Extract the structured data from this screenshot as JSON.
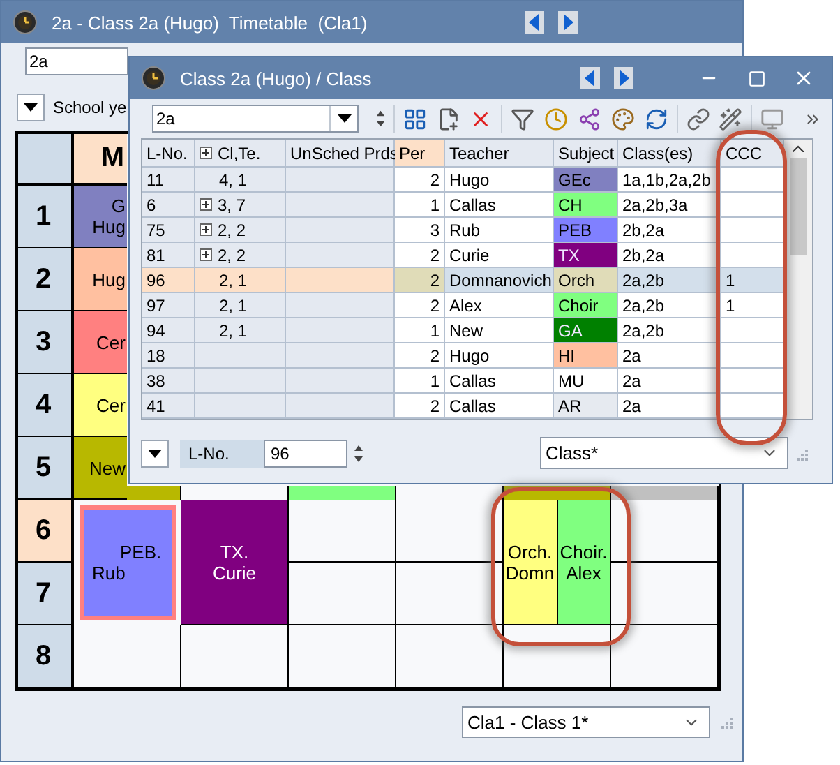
{
  "timetable_window": {
    "title": "2a - Class 2a (Hugo)  Timetable  (Cla1)",
    "class_field": {
      "value": "2a"
    },
    "view_label": "School ye",
    "day_headers": [
      {
        "label": "M",
        "highlighted": true
      }
    ],
    "periods": [
      {
        "label": "1",
        "highlighted": false,
        "cells": [
          {
            "kind": "lesson",
            "lines": [
              "G",
              "Hug"
            ],
            "color": "#8080c0"
          }
        ]
      },
      {
        "label": "2",
        "highlighted": false,
        "cells": [
          {
            "kind": "lesson",
            "lines": [
              "Hug"
            ],
            "color": "#ffc0a0"
          }
        ]
      },
      {
        "label": "3",
        "highlighted": false,
        "cells": [
          {
            "kind": "lesson",
            "lines": [
              "Cer"
            ],
            "color": "#ff8080"
          }
        ]
      },
      {
        "label": "4",
        "highlighted": false,
        "cells": [
          {
            "kind": "lesson",
            "lines": [
              "Cer"
            ],
            "color": "#ffff80"
          }
        ]
      },
      {
        "label": "5",
        "highlighted": false,
        "cells": [
          {
            "kind": "lesson",
            "lines": [
              "New"
            ],
            "color": "#b8b800"
          },
          {
            "kind": "empty"
          },
          {
            "kind": "block",
            "color": "#80ff80"
          },
          {
            "kind": "empty"
          },
          {
            "kind": "block",
            "color": "#b8b800"
          },
          {
            "kind": "block",
            "color": "#c0c0c0"
          }
        ]
      },
      {
        "label": "6",
        "highlighted": true,
        "cells": [
          {
            "kind": "lesson",
            "lines": [
              "PEB.",
              "Rub"
            ],
            "color": "#8080ff",
            "double": true,
            "marked": true
          },
          {
            "kind": "lesson",
            "lines": [
              "TX.",
              "Curie"
            ],
            "color": "#800080",
            "double": true,
            "marked": false
          },
          {
            "kind": "empty"
          },
          {
            "kind": "empty"
          },
          {
            "kind": "split",
            "double": true,
            "circled": true,
            "parts": [
              {
                "lines": [
                  "Orch.",
                  "Domn"
                ],
                "color": "#ffff80"
              },
              {
                "lines": [
                  "Choir.",
                  "Alex"
                ],
                "color": "#80ff80"
              }
            ]
          },
          {
            "kind": "empty"
          }
        ]
      },
      {
        "label": "7",
        "highlighted": false,
        "cells": [
          {
            "kind": "covered"
          },
          {
            "kind": "covered"
          },
          {
            "kind": "empty"
          },
          {
            "kind": "empty"
          },
          {
            "kind": "covered"
          },
          {
            "kind": "empty"
          }
        ]
      },
      {
        "label": "8",
        "highlighted": false,
        "cells": [
          {
            "kind": "empty"
          },
          {
            "kind": "empty"
          },
          {
            "kind": "empty"
          },
          {
            "kind": "empty"
          },
          {
            "kind": "empty"
          },
          {
            "kind": "empty"
          }
        ]
      }
    ],
    "format_select": {
      "value": "Cla1 - Class 1*"
    }
  },
  "class_window": {
    "title": "Class 2a (Hugo) / Class",
    "class_field": {
      "value": "2a"
    },
    "columns": [
      {
        "label": "L-No.",
        "expandable": false,
        "highlighted": false,
        "circled": false
      },
      {
        "label": "Cl,Te.",
        "expandable": true,
        "highlighted": false,
        "circled": false
      },
      {
        "label": "UnSched Prds",
        "expandable": false,
        "highlighted": false,
        "circled": false
      },
      {
        "label": "Per",
        "expandable": false,
        "highlighted": true,
        "circled": false
      },
      {
        "label": "Teacher",
        "expandable": false,
        "highlighted": false,
        "circled": false
      },
      {
        "label": "Subject",
        "expandable": false,
        "highlighted": false,
        "circled": false
      },
      {
        "label": "Class(es)",
        "expandable": false,
        "highlighted": false,
        "circled": false
      },
      {
        "label": "CCC",
        "expandable": false,
        "highlighted": false,
        "circled": true
      }
    ],
    "rows": [
      {
        "lno": "11",
        "cl_te": "4, 1",
        "expandable": false,
        "per": "2",
        "teacher": "Hugo",
        "subject": "GEc",
        "color": "#8080c0",
        "classes": "1a,1b,2a,2b",
        "selected": false
      },
      {
        "lno": "6",
        "cl_te": "3, 7",
        "expandable": true,
        "per": "1",
        "teacher": "Callas",
        "subject": "CH",
        "color": "#80ff80",
        "classes": "2a,2b,3a",
        "selected": false
      },
      {
        "lno": "75",
        "cl_te": "2, 2",
        "expandable": true,
        "per": "3",
        "teacher": "Rub",
        "subject": "PEB",
        "color": "#8080ff",
        "classes": "2b,2a",
        "selected": false
      },
      {
        "lno": "81",
        "cl_te": "2, 2",
        "expandable": true,
        "per": "2",
        "teacher": "Curie",
        "subject": "TX",
        "color": "#800080",
        "classes": "2b,2a",
        "selected": false
      },
      {
        "lno": "96",
        "cl_te": "2, 1",
        "expandable": false,
        "per": "2",
        "teacher": "Domnanovich",
        "subject": "Orch",
        "color": "#e0dcb8",
        "classes": "2a,2b",
        "ccc": "1",
        "selected": true
      },
      {
        "lno": "97",
        "cl_te": "2, 1",
        "expandable": false,
        "per": "2",
        "teacher": "Alex",
        "subject": "Choir",
        "color": "#80ff80",
        "classes": "2a,2b",
        "ccc": "1",
        "selected": false
      },
      {
        "lno": "94",
        "cl_te": "2, 1",
        "expandable": false,
        "per": "1",
        "teacher": "New",
        "subject": "GA",
        "color": "#008000",
        "classes": "2a,2b",
        "selected": false
      },
      {
        "lno": "18",
        "expandable": false,
        "per": "2",
        "teacher": "Hugo",
        "subject": "HI",
        "color": "#ffc0a0",
        "classes": "2a",
        "selected": false
      },
      {
        "lno": "38",
        "expandable": false,
        "per": "1",
        "teacher": "Callas",
        "subject": "MU",
        "color": "#ffffff",
        "classes": "2a",
        "selected": false
      },
      {
        "lno": "41",
        "expandable": false,
        "per": "2",
        "teacher": "Callas",
        "subject": "AR",
        "color": "#e6eaf0",
        "classes": "2a",
        "selected": false
      }
    ],
    "footer": {
      "field_label": "L-No.",
      "field_value": "96",
      "view_select": {
        "value": "Class*"
      }
    }
  }
}
